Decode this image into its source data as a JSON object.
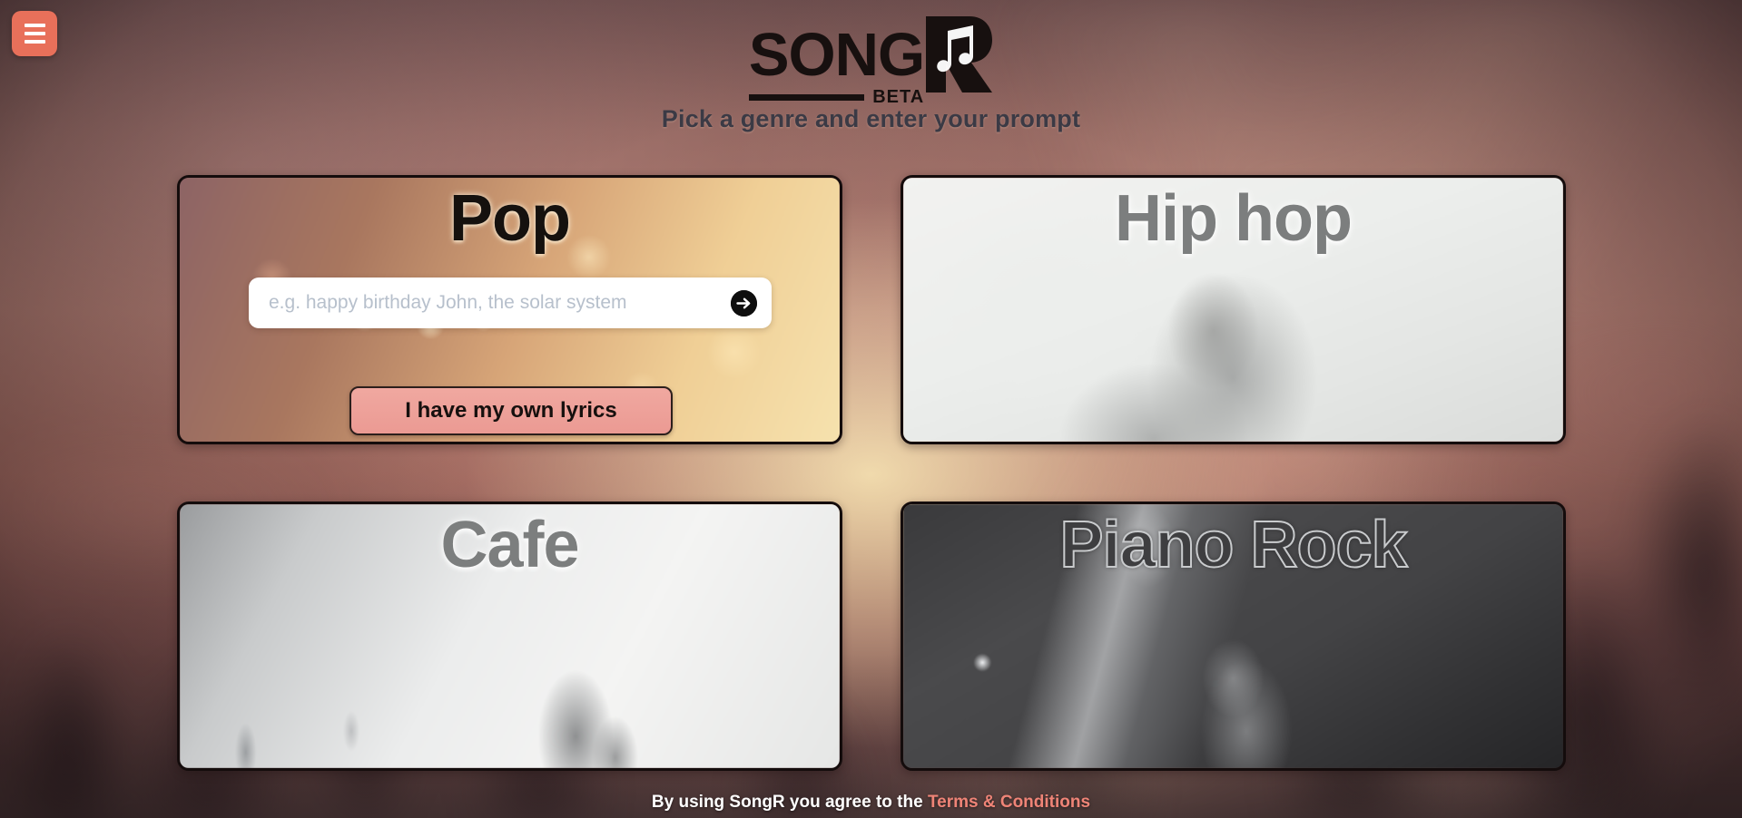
{
  "menu": {
    "icon": "hamburger-icon",
    "label": "Menu"
  },
  "header": {
    "logo_word": "SONG",
    "logo_badge": "BETA",
    "logo_mark": "r-note-mark",
    "subtitle": "Pick a genre and enter your prompt"
  },
  "prompt": {
    "placeholder": "e.g. happy birthday John, the solar system",
    "value": "",
    "submit_icon": "arrow-right-circle-icon",
    "lyrics_button": "I have my own lyrics"
  },
  "genres": [
    {
      "id": "pop",
      "title": "Pop",
      "style": "dark"
    },
    {
      "id": "hiphop",
      "title": "Hip hop",
      "style": "gray"
    },
    {
      "id": "cafe",
      "title": "Cafe",
      "style": "gray"
    },
    {
      "id": "pianorock",
      "title": "Piano Rock",
      "style": "outline"
    }
  ],
  "footer": {
    "text": "By using SongR you agree to the",
    "link": "Terms & Conditions"
  },
  "colors": {
    "accent": "#e8705a",
    "button_fill": "#eb9a93",
    "link": "#ef8477",
    "border": "#140c0c",
    "subtitle": "#3b3a45"
  }
}
